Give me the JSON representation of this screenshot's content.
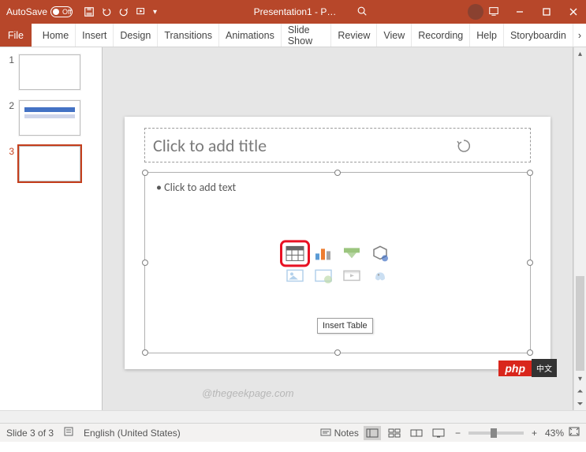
{
  "titlebar": {
    "autosave_label": "AutoSave",
    "autosave_state": "Off",
    "doc_title": "Presentation1 - P…"
  },
  "ribbon": {
    "file": "File",
    "tabs": [
      "Home",
      "Insert",
      "Design",
      "Transitions",
      "Animations",
      "Slide Show",
      "Review",
      "View",
      "Recording",
      "Help",
      "Storyboardin"
    ]
  },
  "thumbnails": {
    "items": [
      {
        "num": "1"
      },
      {
        "num": "2"
      },
      {
        "num": "3"
      }
    ]
  },
  "slide": {
    "title_placeholder": "Click to add title",
    "body_placeholder": "Click to add text",
    "tooltip": "Insert Table"
  },
  "watermark": "@thegeekpage.com",
  "status": {
    "slide_counter": "Slide 3 of 3",
    "language": "English (United States)",
    "notes_label": "Notes",
    "zoom_text": "43%"
  },
  "badge": {
    "php": "php",
    "cn": "中文"
  }
}
